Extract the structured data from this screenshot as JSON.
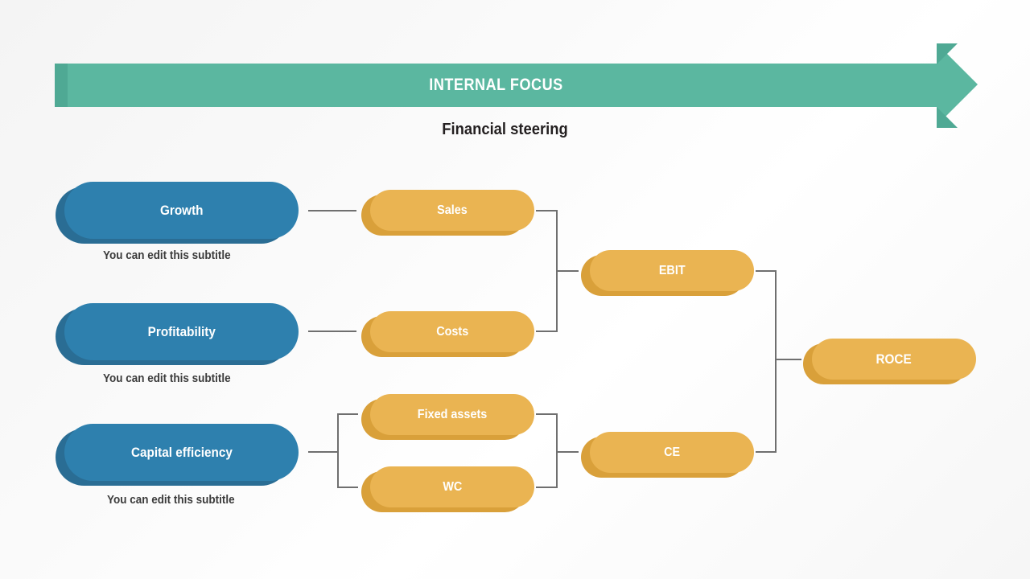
{
  "slide": {
    "background_color": "#fafafa",
    "banner": {
      "title": "INTERNAL FOCUS",
      "color": "#5bb7a0",
      "cap_color": "#4fa994",
      "text_color": "#ffffff",
      "shape": "right-arrow"
    },
    "subtitle": "Financial steering"
  },
  "colors": {
    "blue": "#2e80ae",
    "blue_shadow": "#2a6d94",
    "yellow": "#eab452",
    "yellow_shadow": "#d9a03a",
    "green": "#5bb7a0",
    "connector": "#6f6f6f",
    "text_dark": "#231f20"
  },
  "drivers": [
    {
      "label": "Growth",
      "subtitle": "You can edit this subtitle",
      "color": "#2e80ae"
    },
    {
      "label": "Profitability",
      "subtitle": "You can edit this subtitle",
      "color": "#2e80ae"
    },
    {
      "label": "Capital efficiency",
      "subtitle": "You can edit this subtitle",
      "color": "#2e80ae"
    }
  ],
  "metrics_level1": [
    {
      "label": "Sales",
      "color": "#eab452"
    },
    {
      "label": "Costs",
      "color": "#eab452"
    },
    {
      "label": "Fixed assets",
      "color": "#eab452"
    },
    {
      "label": "WC",
      "color": "#eab452"
    }
  ],
  "metrics_level2": [
    {
      "label": "EBIT",
      "color": "#eab452"
    },
    {
      "label": "CE",
      "color": "#eab452"
    }
  ],
  "metrics_level3": [
    {
      "label": "ROCE",
      "color": "#eab452"
    }
  ],
  "chart_data": {
    "type": "diagram",
    "title": "INTERNAL FOCUS",
    "subtitle": "Financial steering",
    "nodes": [
      {
        "id": "growth",
        "label": "Growth",
        "level": 0,
        "color": "#2e80ae"
      },
      {
        "id": "profitability",
        "label": "Profitability",
        "level": 0,
        "color": "#2e80ae"
      },
      {
        "id": "capital_eff",
        "label": "Capital efficiency",
        "level": 0,
        "color": "#2e80ae"
      },
      {
        "id": "sales",
        "label": "Sales",
        "level": 1,
        "color": "#eab452"
      },
      {
        "id": "costs",
        "label": "Costs",
        "level": 1,
        "color": "#eab452"
      },
      {
        "id": "fixed_assets",
        "label": "Fixed assets",
        "level": 1,
        "color": "#eab452"
      },
      {
        "id": "wc",
        "label": "WC",
        "level": 1,
        "color": "#eab452"
      },
      {
        "id": "ebit",
        "label": "EBIT",
        "level": 2,
        "color": "#eab452"
      },
      {
        "id": "ce",
        "label": "CE",
        "level": 2,
        "color": "#eab452"
      },
      {
        "id": "roce",
        "label": "ROCE",
        "level": 3,
        "color": "#eab452"
      }
    ],
    "edges": [
      {
        "from": "growth",
        "to": "sales"
      },
      {
        "from": "profitability",
        "to": "costs"
      },
      {
        "from": "capital_eff",
        "to": "fixed_assets"
      },
      {
        "from": "capital_eff",
        "to": "wc"
      },
      {
        "from": "sales",
        "to": "ebit"
      },
      {
        "from": "costs",
        "to": "ebit"
      },
      {
        "from": "fixed_assets",
        "to": "ce"
      },
      {
        "from": "wc",
        "to": "ce"
      },
      {
        "from": "ebit",
        "to": "roce"
      },
      {
        "from": "ce",
        "to": "roce"
      }
    ]
  }
}
